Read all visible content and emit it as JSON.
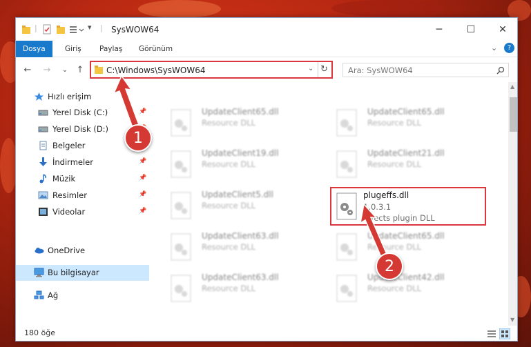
{
  "window": {
    "title": "SysWOW64",
    "minimize_glyph": "─",
    "maximize_glyph": "☐",
    "close_glyph": "✕"
  },
  "ribbon": {
    "tabs": [
      "Dosya",
      "Giriş",
      "Paylaş",
      "Görünüm"
    ],
    "help_glyph": "?"
  },
  "navigation": {
    "back_glyph": "←",
    "forward_glyph": "→",
    "recent_glyph": "⌄",
    "up_glyph": "↑",
    "address": "C:\\Windows\\SysWOW64",
    "search_placeholder": "Ara: SysWOW64"
  },
  "sidebar": {
    "items": [
      {
        "label": "Hızlı erişim",
        "icon": "star-icon"
      },
      {
        "label": "Yerel Disk (C:)",
        "icon": "drive-icon"
      },
      {
        "label": "Yerel Disk (D:)",
        "icon": "drive-icon"
      },
      {
        "label": "Belgeler",
        "icon": "document-icon"
      },
      {
        "label": "İndirmeler",
        "icon": "download-icon"
      },
      {
        "label": "Müzik",
        "icon": "music-icon"
      },
      {
        "label": "Resimler",
        "icon": "picture-icon"
      },
      {
        "label": "Videolar",
        "icon": "video-icon"
      },
      {
        "label": "OneDrive",
        "icon": "cloud-icon"
      },
      {
        "label": "Bu bilgisayar",
        "icon": "computer-icon"
      },
      {
        "label": "Ağ",
        "icon": "network-icon"
      }
    ]
  },
  "files": [
    {
      "name": "UpdateClient65.dll",
      "desc": "Resource DLL"
    },
    {
      "name": "UpdateClient65.dll",
      "desc": "Resource DLL"
    },
    {
      "name": "UpdateClient19.dll",
      "desc": "Resource DLL"
    },
    {
      "name": "UpdateClient21.dll",
      "desc": "Resource DLL"
    },
    {
      "name": "UpdateClient5.dll",
      "desc": "Resource DLL"
    },
    {
      "name": "plugeffs.dll",
      "version": "1.0.3.1",
      "desc": "Effects plugin DLL"
    },
    {
      "name": "UpdateClient63.dll",
      "desc": "Resource DLL"
    },
    {
      "name": "UpdateClient65.dll",
      "desc": "Resource DLL"
    },
    {
      "name": "UpdateClient63.dll",
      "desc": "Resource DLL"
    },
    {
      "name": "UpdateClient42.dll",
      "desc": "Resource DLL"
    }
  ],
  "status": {
    "item_count": "180 öğe"
  },
  "callouts": [
    "1",
    "2"
  ],
  "colors": {
    "accent": "#1979ca",
    "highlight_red": "#d9363e",
    "callout_red": "#d43a33"
  }
}
